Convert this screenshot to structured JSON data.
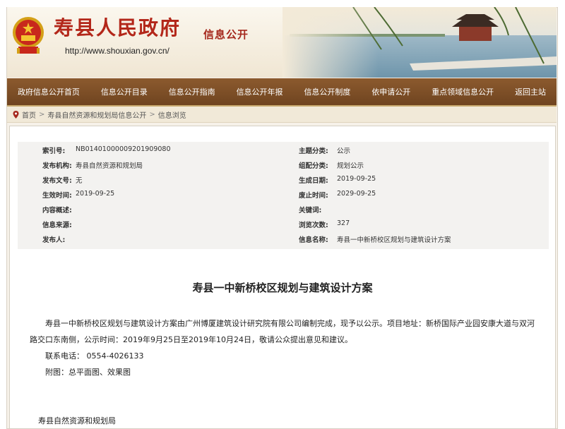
{
  "header": {
    "site_title": "寿县人民政府",
    "site_url": "http://www.shouxian.gov.cn/",
    "section_title": "信息公开"
  },
  "nav": {
    "items": [
      "政府信息公开首页",
      "信息公开目录",
      "信息公开指南",
      "信息公开年报",
      "信息公开制度",
      "依申请公开",
      "重点领域信息公开",
      "返回主站"
    ]
  },
  "breadcrumb": {
    "items": [
      "首页",
      "寿县自然资源和规划局信息公开",
      "信息浏览"
    ],
    "separator": ">"
  },
  "meta": {
    "left": [
      {
        "label": "索引号:",
        "value": "NB01401000009201909080"
      },
      {
        "label": "发布机构:",
        "value": "寿县自然资源和规划局"
      },
      {
        "label": "发布文号:",
        "value": "无"
      },
      {
        "label": "生效时间:",
        "value": "2019-09-25"
      },
      {
        "label": "内容概述:",
        "value": ""
      },
      {
        "label": "信息来源:",
        "value": ""
      },
      {
        "label": "发布人:",
        "value": ""
      }
    ],
    "right": [
      {
        "label": "主题分类:",
        "value": "公示"
      },
      {
        "label": "组配分类:",
        "value": "规划公示"
      },
      {
        "label": "生成日期:",
        "value": "2019-09-25"
      },
      {
        "label": "废止时间:",
        "value": "2029-09-25"
      },
      {
        "label": "关键词:",
        "value": ""
      },
      {
        "label": "浏览次数:",
        "value": "327"
      },
      {
        "label": "信息名称:",
        "value": "寿县一中新桥校区规划与建筑设计方案"
      }
    ]
  },
  "document": {
    "title": "寿县一中新桥校区规划与建筑设计方案",
    "paragraph1": "寿县一中新桥校区规划与建筑设计方案由广州博厦建筑设计研究院有限公司编制完成，现予以公示。项目地址：新桥国际产业园安康大道与双河路交口东南侧，公示时间：2019年9月25日至2019年10月24日，敬请公众提出意见和建议。",
    "contact": "联系电话： 0554-4026133",
    "attachments": "附图：总平面图、效果图",
    "signature": "寿县自然资源和规划局"
  },
  "colors": {
    "nav_bg": "#7a4c25",
    "title_red": "#b3271a",
    "meta_bg": "#f3f2f0"
  }
}
